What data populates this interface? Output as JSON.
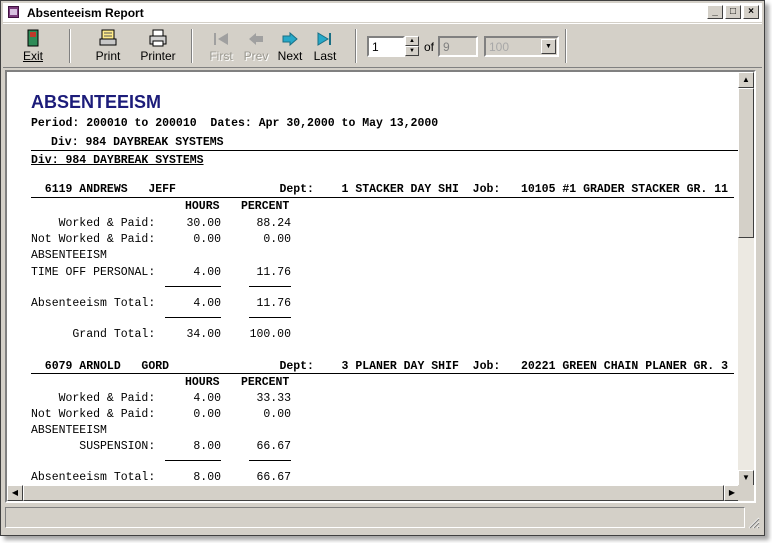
{
  "window": {
    "title": "Absenteeism Report"
  },
  "toolbar": {
    "exit": "Exit",
    "print": "Print",
    "printer": "Printer",
    "first": "First",
    "prev": "Prev",
    "next": "Next",
    "last": "Last",
    "page_current": "1",
    "of_label": "of",
    "page_total": "9",
    "zoom": "100"
  },
  "report": {
    "title": "ABSENTEEISM",
    "period_line": "Period: 200010 to 200010  Dates: Apr 30,2000 to May 13,2000",
    "div_line": "Div: 984 DAYBREAK SYSTEMS",
    "div_heading": "Div: 984 DAYBREAK SYSTEMS",
    "col_hours": "HOURS",
    "col_percent": "PERCENT",
    "employees": [
      {
        "header": "  6119 ANDREWS   JEFF               Dept:    1 STACKER DAY SHI  Job:   10105 #1 GRADER STACKER GR. 11",
        "worked_label": "    Worked & Paid:",
        "worked_hours": "30.00",
        "worked_pct": "88.24",
        "notworked_label": "Not Worked & Paid:",
        "notworked_hours": "0.00",
        "notworked_pct": "0.00",
        "abs_label": "ABSENTEEISM",
        "item_label": "TIME OFF PERSONAL:",
        "item_hours": "4.00",
        "item_pct": "11.76",
        "abs_total_label": "Absenteeism Total:",
        "abs_total_hours": "4.00",
        "abs_total_pct": "11.76",
        "grand_label": "      Grand Total:",
        "grand_hours": "34.00",
        "grand_pct": "100.00"
      },
      {
        "header": "  6079 ARNOLD   GORD                Dept:    3 PLANER DAY SHIF  Job:   20221 GREEN CHAIN PLANER GR. 3",
        "worked_label": "    Worked & Paid:",
        "worked_hours": "4.00",
        "worked_pct": "33.33",
        "notworked_label": "Not Worked & Paid:",
        "notworked_hours": "0.00",
        "notworked_pct": "0.00",
        "abs_label": "ABSENTEEISM",
        "item_label": "       SUSPENSION:",
        "item_hours": "8.00",
        "item_pct": "66.67",
        "abs_total_label": "Absenteeism Total:",
        "abs_total_hours": "8.00",
        "abs_total_pct": "66.67"
      }
    ]
  },
  "icons": {
    "exit": "exit-door-icon",
    "print": "print-page-icon",
    "printer": "printer-icon",
    "first": "first-page-icon",
    "prev": "prev-page-icon",
    "next": "next-page-icon",
    "last": "last-page-icon"
  }
}
